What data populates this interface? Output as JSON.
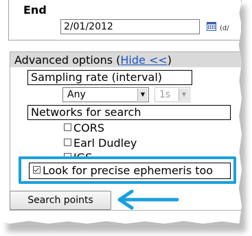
{
  "end": {
    "label": "End",
    "date_value": "2/01/2012",
    "date_hint": "(d/",
    "calendar_icon": "calendar-icon"
  },
  "advanced": {
    "title": "Advanced options (",
    "hide_link": "Hide <<",
    "title_close": ")",
    "sampling": {
      "label": "Sampling rate (interval)",
      "select_value": "Any",
      "interval_value": "1s"
    },
    "networks": {
      "label": "Networks for search",
      "items": [
        {
          "label": "CORS",
          "checked": false
        },
        {
          "label": "Earl Dudley",
          "checked": false
        },
        {
          "label": "IGS",
          "checked": false
        }
      ]
    },
    "precise": {
      "label": "Look for precise ephemeris too",
      "checked": true
    }
  },
  "search_button": "Search points",
  "colors": {
    "highlight": "#1aa0dc",
    "link": "#1a55c4"
  }
}
